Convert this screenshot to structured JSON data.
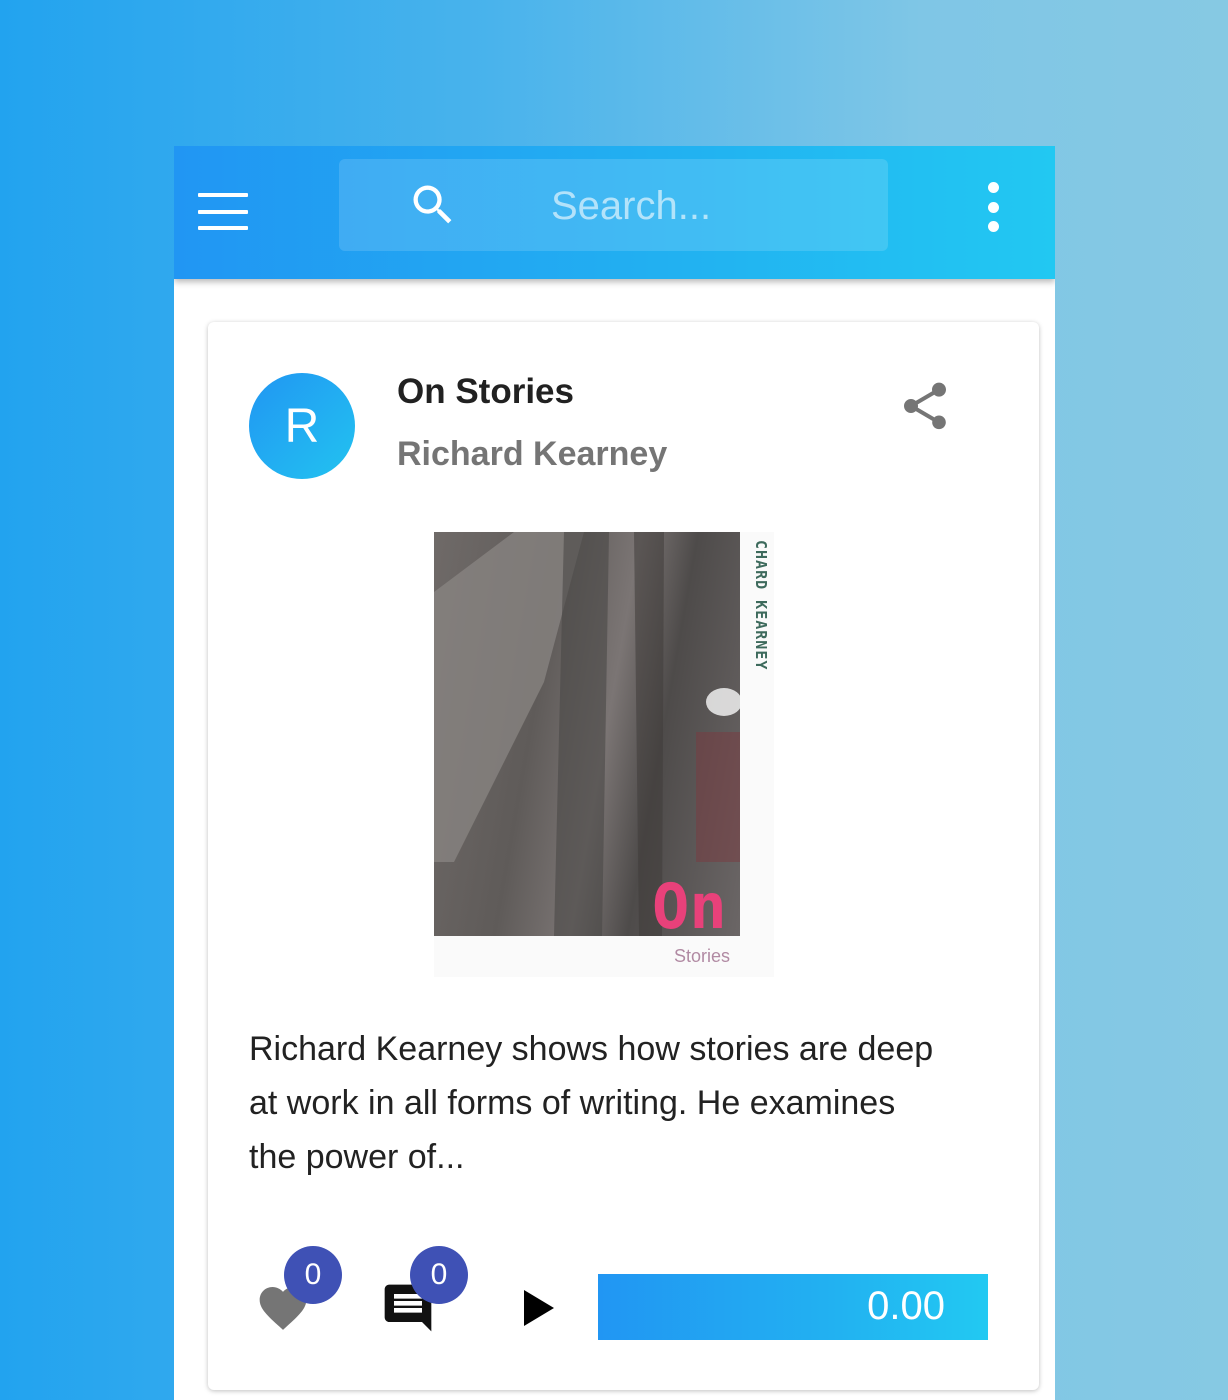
{
  "appbar": {
    "search_placeholder": "Search..."
  },
  "post": {
    "avatar_initial": "R",
    "title": "On Stories",
    "author": "Richard Kearney",
    "cover": {
      "spine_text": "CHARD KEARNEY",
      "big_word": "On",
      "small_word": "Stories"
    },
    "description": "Richard Kearney shows how stories are deep at work in all forms of writing. He examines the power of..."
  },
  "actions": {
    "likes_count": "0",
    "comments_count": "0",
    "progress_value": "0.00"
  },
  "colors": {
    "accent_blue": "#2196f3",
    "accent_cyan": "#22c9f2",
    "badge": "#3f51b5"
  },
  "icons": [
    "menu-icon",
    "search-icon",
    "more-vert-icon",
    "share-icon",
    "heart-icon",
    "comment-icon",
    "play-icon"
  ]
}
